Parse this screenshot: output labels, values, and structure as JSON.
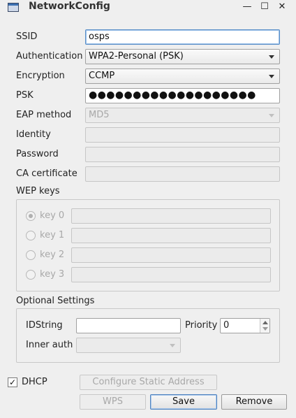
{
  "window": {
    "title": "NetworkConfig",
    "controls": {
      "minimize": "—",
      "maximize": "☐",
      "close": "✕"
    }
  },
  "form": {
    "ssid": {
      "label": "SSID",
      "value": "osps"
    },
    "authentication": {
      "label": "Authentication",
      "value": "WPA2-Personal (PSK)"
    },
    "encryption": {
      "label": "Encryption",
      "value": "CCMP"
    },
    "psk": {
      "label": "PSK",
      "value": "●●●●●●●●●●●●●●●●●●●"
    },
    "eap_method": {
      "label": "EAP method",
      "value": "MD5"
    },
    "identity": {
      "label": "Identity",
      "value": ""
    },
    "password": {
      "label": "Password",
      "value": ""
    },
    "ca_certificate": {
      "label": "CA certificate",
      "value": ""
    }
  },
  "wep": {
    "title": "WEP keys",
    "keys": [
      {
        "label": "key 0",
        "value": "",
        "checked": true
      },
      {
        "label": "key 1",
        "value": "",
        "checked": false
      },
      {
        "label": "key 2",
        "value": "",
        "checked": false
      },
      {
        "label": "key 3",
        "value": "",
        "checked": false
      }
    ]
  },
  "optional": {
    "title": "Optional Settings",
    "idstring": {
      "label": "IDString",
      "value": ""
    },
    "priority": {
      "label": "Priority",
      "value": "0"
    },
    "inner_auth": {
      "label": "Inner auth",
      "value": ""
    }
  },
  "dhcp": {
    "label": "DHCP",
    "checked": true,
    "checkmark": "✓"
  },
  "buttons": {
    "configure_static": "Configure Static Address",
    "wps": "WPS",
    "save": "Save",
    "remove": "Remove"
  }
}
